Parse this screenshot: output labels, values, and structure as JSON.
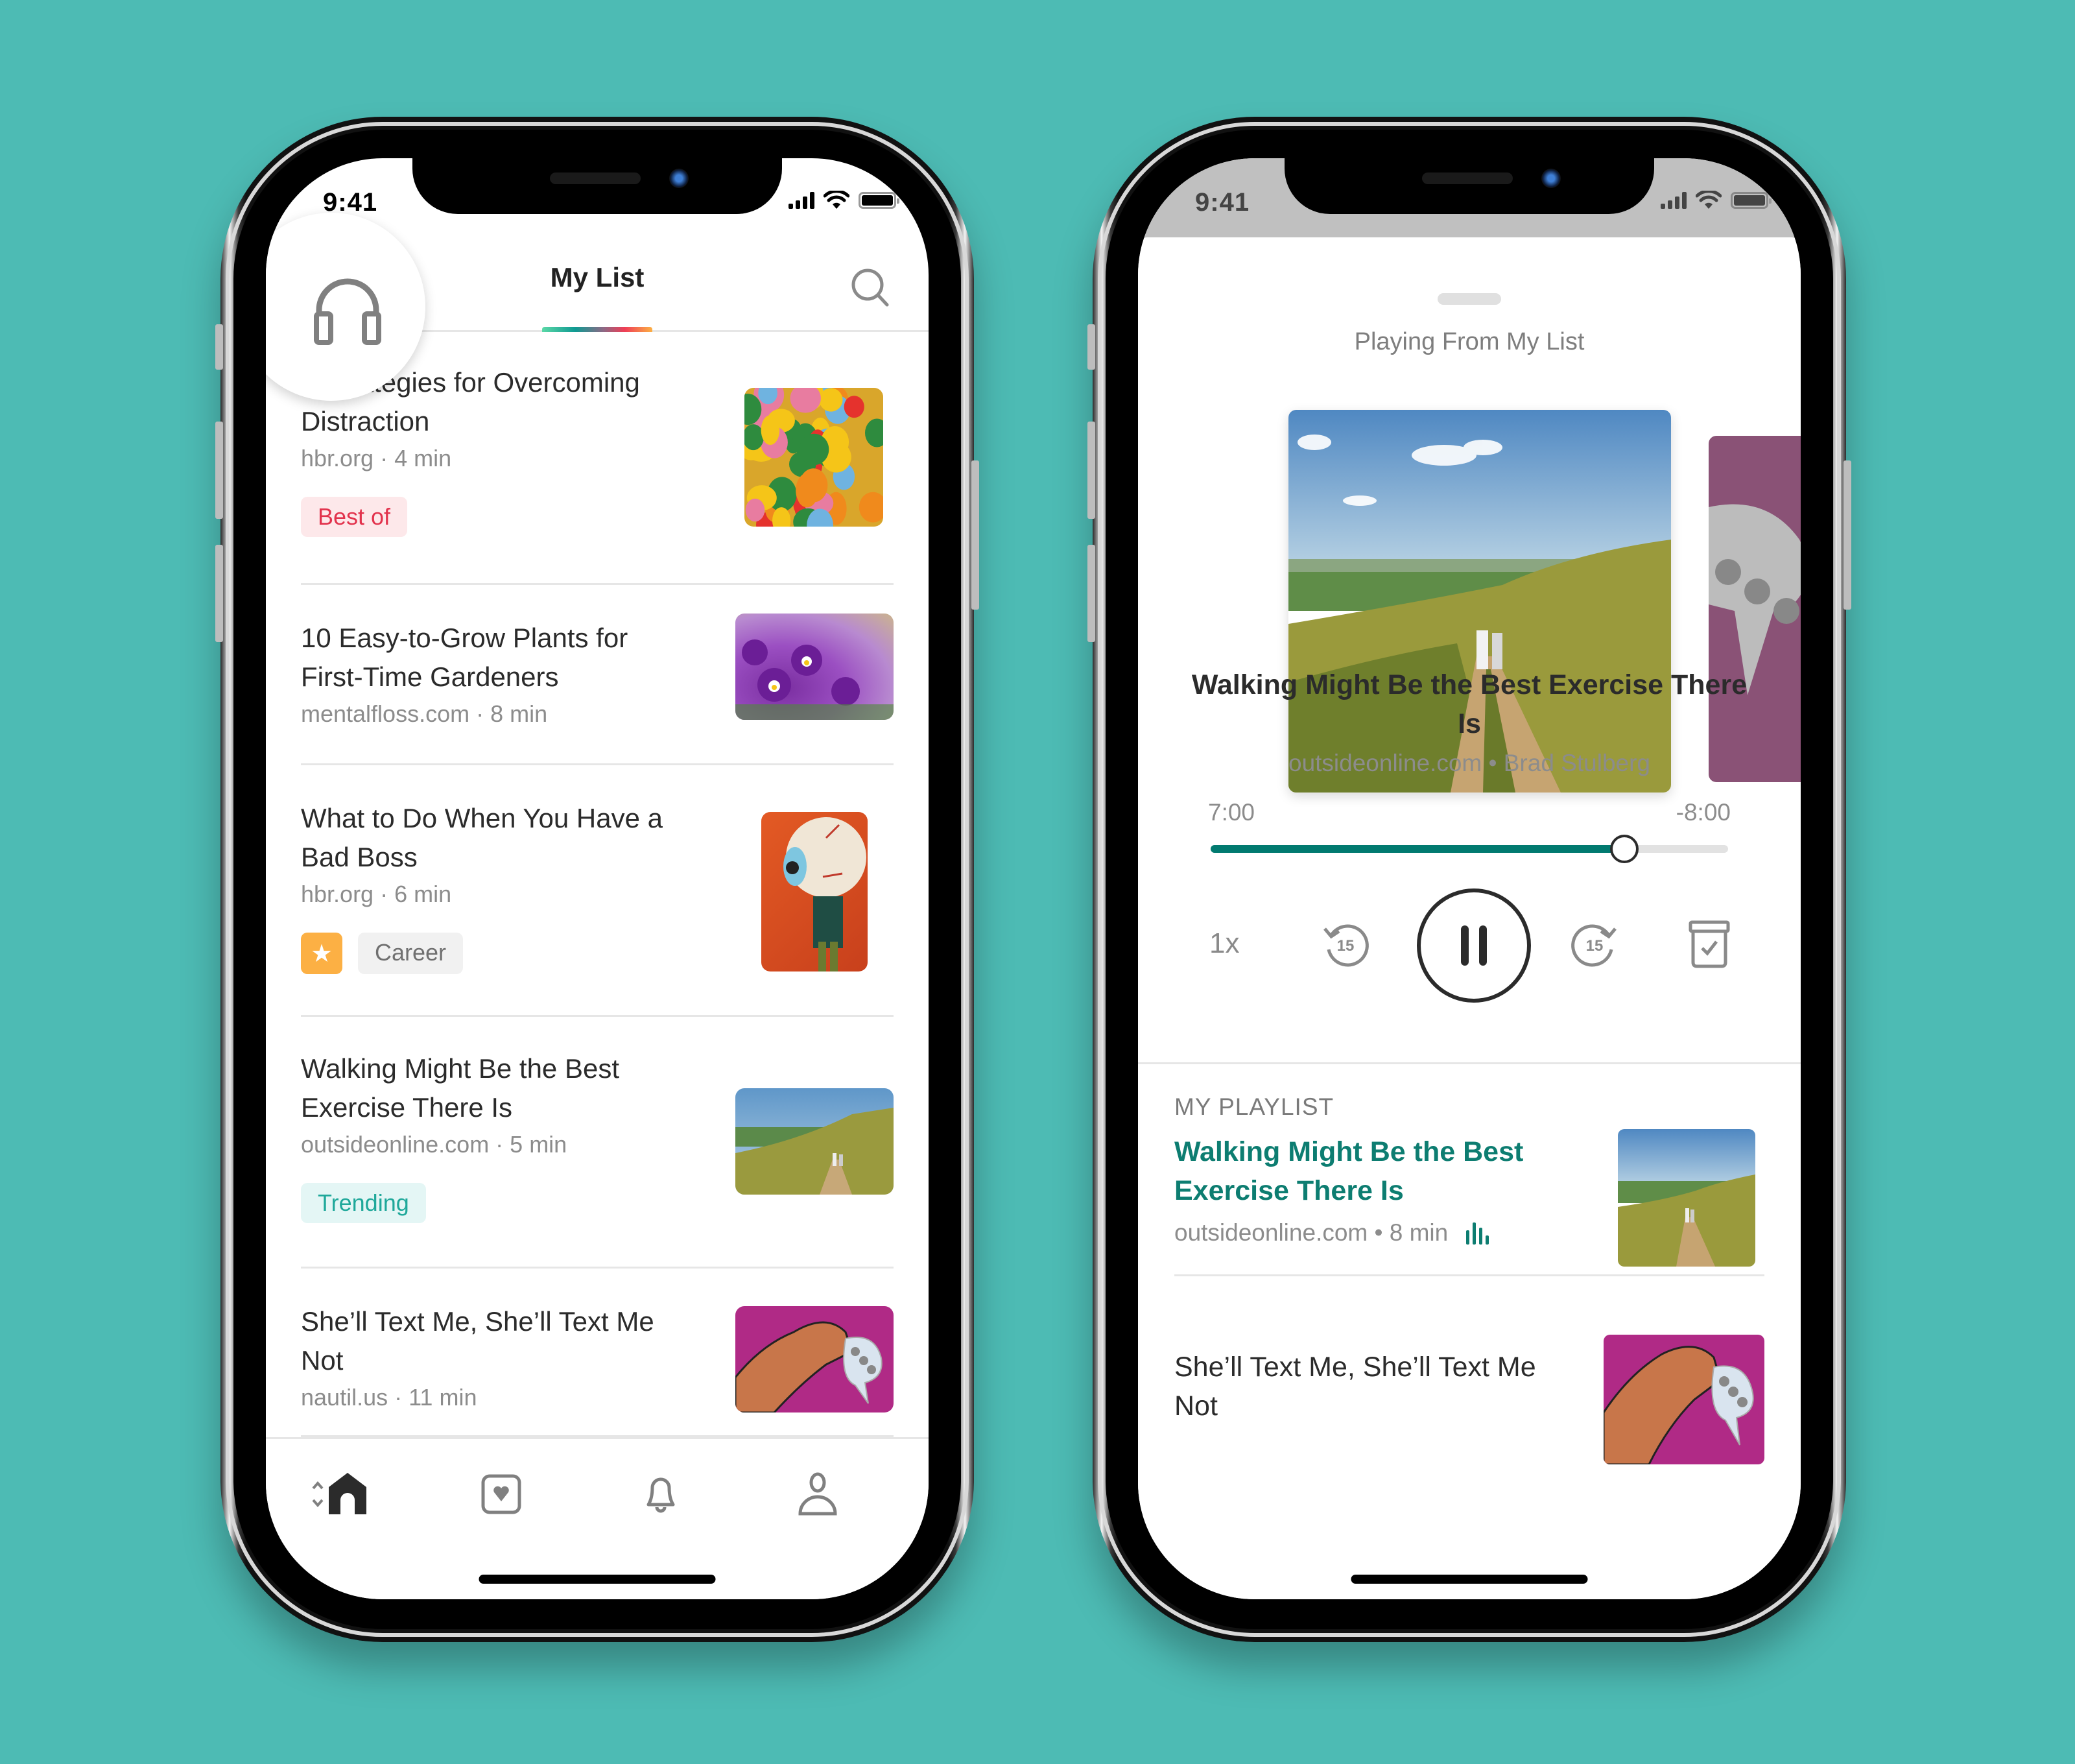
{
  "background_color": "#4dbbb4",
  "left_phone": {
    "status_bar": {
      "time": "9:41"
    },
    "header": {
      "title": "My List",
      "listen_icon": "headphones-icon",
      "search_icon": "search-icon"
    },
    "articles": [
      {
        "title": "4 Strategies for Overcoming Distraction",
        "meta": "hbr.org · 4 min",
        "tags": [
          "Best of"
        ],
        "thumbnail": "colorful-balloons"
      },
      {
        "title": "10 Easy-to-Grow Plants for First-Time Gardeners",
        "meta": "mentalfloss.com · 8 min",
        "tags": [],
        "thumbnail": "purple-pansies"
      },
      {
        "title": "What to Do When You Have a Bad Boss",
        "meta": "hbr.org · 6 min",
        "favorite": true,
        "tags": [
          "Career"
        ],
        "thumbnail": "eyeball-head-man"
      },
      {
        "title": "Walking Might Be the Best Exercise There Is",
        "meta": "outsideonline.com · 5 min",
        "tags": [
          "Trending"
        ],
        "thumbnail": "hillside-walkers"
      },
      {
        "title": "She’ll Text Me, She’ll Text Me Not",
        "meta": "nautil.us · 11 min",
        "tags": [],
        "thumbnail": "hand-text-bubble"
      }
    ],
    "bottom_nav": [
      {
        "name": "home",
        "icon": "home-icon",
        "active": true
      },
      {
        "name": "discover",
        "icon": "pocket-heart-icon",
        "active": false
      },
      {
        "name": "activity",
        "icon": "bell-icon",
        "active": false
      },
      {
        "name": "profile",
        "icon": "person-icon",
        "active": false
      }
    ]
  },
  "right_phone": {
    "status_bar": {
      "time": "9:41"
    },
    "player": {
      "context_label": "Playing From My List",
      "title": "Walking Might Be the Best Exercise There Is",
      "meta": "outsideonline.com • Brad Stulberg",
      "elapsed": "7:00",
      "remaining": "-8:00",
      "progress_fraction": 0.8,
      "speed": "1x",
      "skip_back_seconds": "15",
      "skip_forward_seconds": "15",
      "state": "playing"
    },
    "playlist": {
      "label": "MY PLAYLIST",
      "items": [
        {
          "title": "Walking Might Be the Best Exercise There Is",
          "meta": "outsideonline.com • 8 min",
          "now_playing": true,
          "accent_color": "#0d7d71"
        },
        {
          "title": "She’ll Text Me, She’ll Text Me Not"
        }
      ]
    }
  }
}
